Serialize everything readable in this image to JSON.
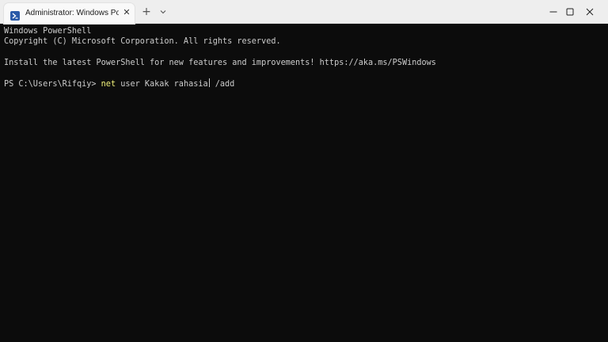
{
  "window": {
    "tab_title": "Administrator: Windows PowerShell",
    "tab_close": "✕",
    "new_tab": "+",
    "tab_dropdown_icon": "chevron-down-icon",
    "tab_icon": "powershell-icon"
  },
  "terminal": {
    "lines": [
      "Windows PowerShell",
      "Copyright (C) Microsoft Corporation. All rights reserved.",
      "",
      "Install the latest PowerShell for new features and improvements! https://aka.ms/PSWindows",
      ""
    ],
    "prompt": "PS C:\\Users\\Rifqiy> ",
    "command_verb": "net",
    "command_args_before_cursor": " user Kakak rahasia",
    "command_args_after_cursor": " /add"
  },
  "colors": {
    "background": "#0c0c0c",
    "text": "#cccccc",
    "command_verb": "#f0f07a",
    "titlebar": "#eeeeee"
  }
}
